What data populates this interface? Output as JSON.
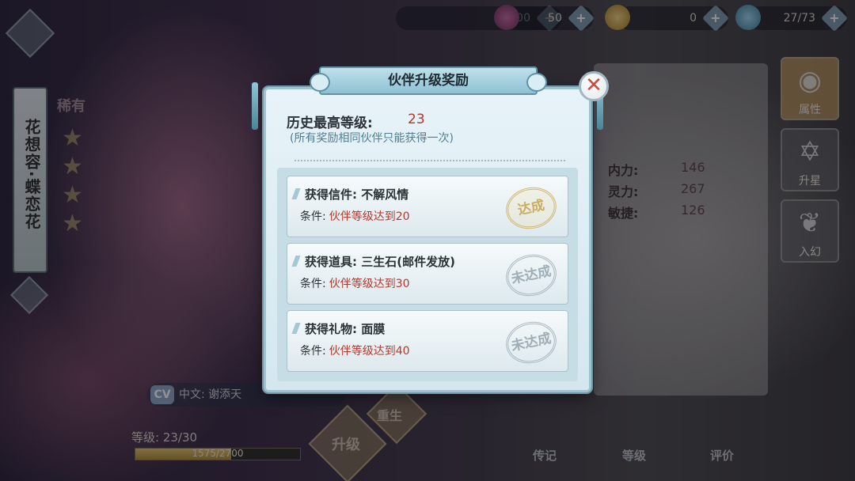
{
  "top_bar": {
    "coins": "52600",
    "gems": "50",
    "gold": "0",
    "stamina": "27/73",
    "plus": "+"
  },
  "character": {
    "name": "花想容·蝶恋花",
    "rarity": "稀有",
    "stars": [
      "★",
      "★",
      "★",
      "★"
    ]
  },
  "attributes": [
    {
      "label": "内力:",
      "value": "146"
    },
    {
      "label": "灵力:",
      "value": "267"
    },
    {
      "label": "敏捷:",
      "value": "126"
    }
  ],
  "side_tabs": [
    {
      "label": "属性",
      "icon": "◉"
    },
    {
      "label": "升星",
      "icon": "✡"
    },
    {
      "label": "入幻",
      "icon": "❦"
    }
  ],
  "cv": {
    "badge": "CV",
    "text": "中文: 谢添天"
  },
  "level": {
    "text": "等级: 23/30",
    "exp_text": "1575/2700",
    "exp_fraction": 0.583
  },
  "bottom_buttons": {
    "rebirth": "重生",
    "upgrade": "升级"
  },
  "bottom_tabs": [
    "传记",
    "等级",
    "评价"
  ],
  "modal": {
    "title": "伙伴升级奖励",
    "close": "✕",
    "history_label": "历史最高等级:",
    "history_value": "23",
    "note": "(所有奖励相同伙伴只能获得一次)",
    "rewards": [
      {
        "title": "获得信件: 不解风情",
        "condition_label": "条件:",
        "condition_text": "伙伴等级达到20",
        "status": "达成"
      },
      {
        "title": "获得道具: 三生石(邮件发放)",
        "condition_label": "条件:",
        "condition_text": "伙伴等级达到30",
        "status": "未达成"
      },
      {
        "title": "获得礼物: 面膜",
        "condition_label": "条件:",
        "condition_text": "伙伴等级达到40",
        "status": "未达成"
      }
    ]
  },
  "colors": {
    "accent_red": "#b0392e",
    "panel_blue": "#d4e7ef",
    "stamp_gold": "#c8aa5a"
  }
}
